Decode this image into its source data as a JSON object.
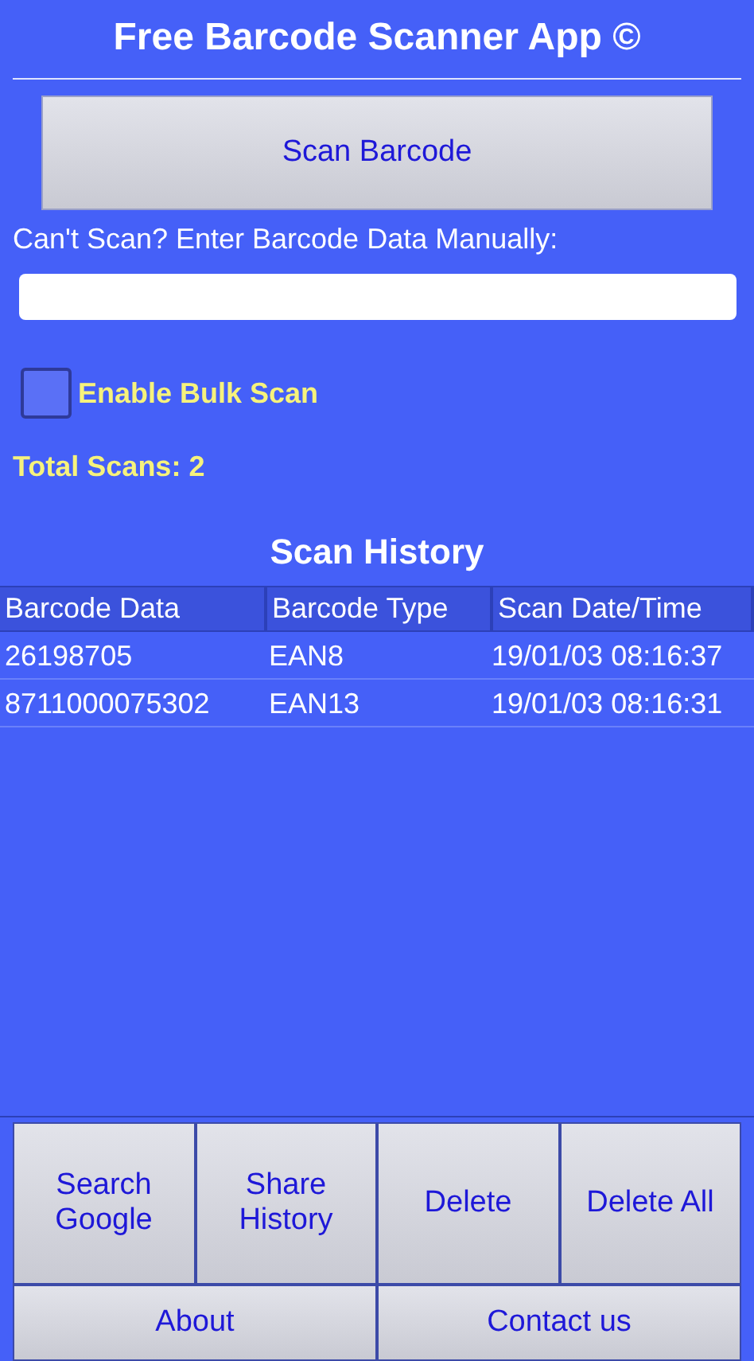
{
  "title": "Free Barcode Scanner App ©",
  "scan_button": "Scan Barcode",
  "manual_entry": {
    "label": "Can't Scan? Enter Barcode Data Manually:"
  },
  "bulk_scan": {
    "label": "Enable Bulk Scan",
    "checked": false
  },
  "total_scans": "Total Scans: 2",
  "history": {
    "title": "Scan History",
    "columns": [
      "Barcode Data",
      "Barcode Type",
      "Scan Date/Time"
    ],
    "rows": [
      {
        "cells": [
          "26198705",
          "EAN8",
          "19/01/03 08:16:37"
        ]
      },
      {
        "cells": [
          "8711000075302",
          "EAN13",
          "19/01/03 08:16:31"
        ]
      }
    ]
  },
  "bottom_buttons": [
    [
      "Search Google",
      "Share History",
      "Delete",
      "Delete All"
    ],
    [
      "About",
      "Contact us"
    ]
  ]
}
